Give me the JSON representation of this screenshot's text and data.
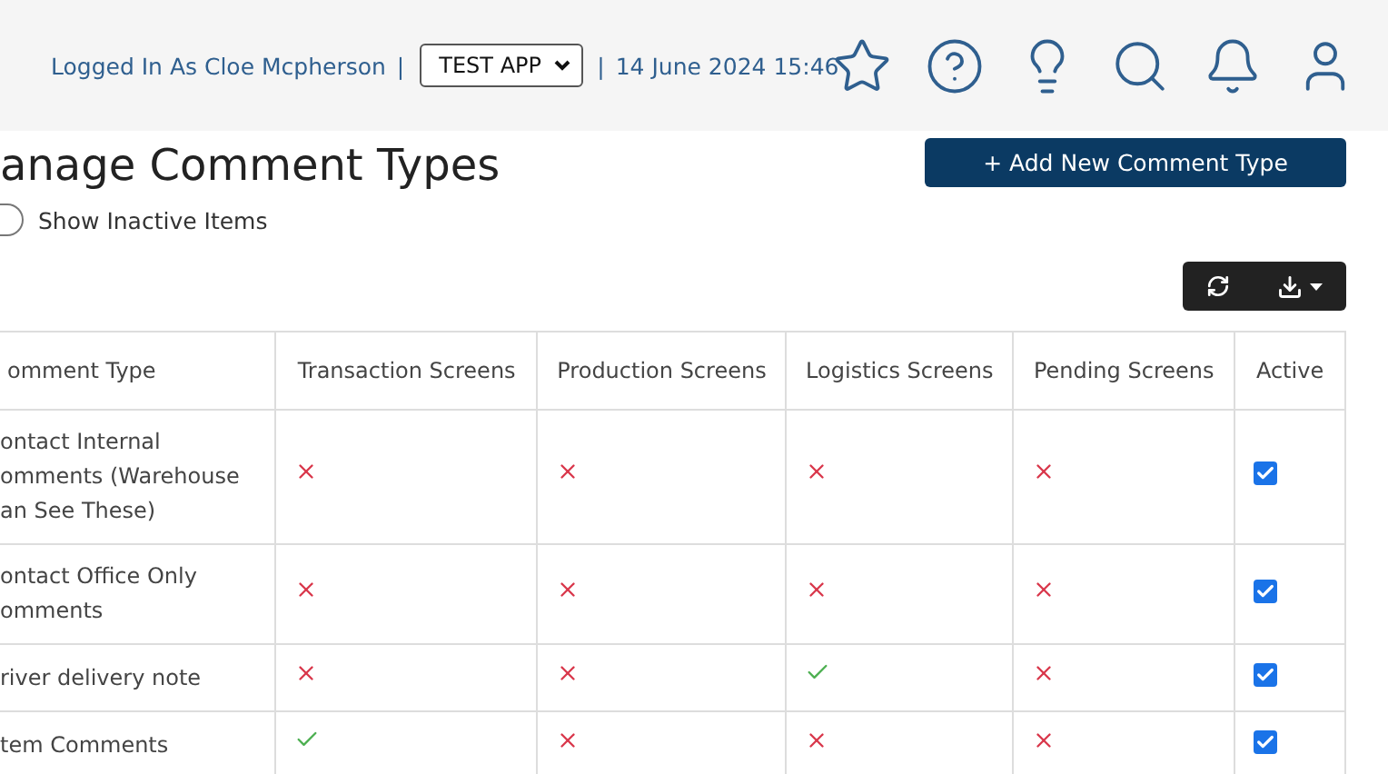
{
  "header": {
    "user_label": "Logged In As Cloe Mcpherson",
    "separator": "|",
    "app_select": "TEST APP",
    "separator_2": "|",
    "datetime": "14 June 2024 15:46"
  },
  "page": {
    "title": "anage Comment Types",
    "add_button": "+ Add New Comment Type",
    "inactive_toggle": {
      "label": "Show Inactive Items",
      "on": false
    }
  },
  "table": {
    "columns": [
      "omment Type",
      "Transaction Screens",
      "Production Screens",
      "Logistics Screens",
      "Pending Screens",
      "Active"
    ],
    "rows": [
      {
        "name": "ontact Internal\nomments (Warehouse\nan See These)",
        "transaction": false,
        "production": false,
        "logistics": false,
        "pending": false,
        "active": true
      },
      {
        "name": "ontact Office Only\nomments",
        "transaction": false,
        "production": false,
        "logistics": false,
        "pending": false,
        "active": true
      },
      {
        "name": "river delivery note",
        "transaction": false,
        "production": false,
        "logistics": true,
        "pending": false,
        "active": true
      },
      {
        "name": "tem Comments",
        "transaction": true,
        "production": false,
        "logistics": false,
        "pending": false,
        "active": true
      }
    ]
  }
}
